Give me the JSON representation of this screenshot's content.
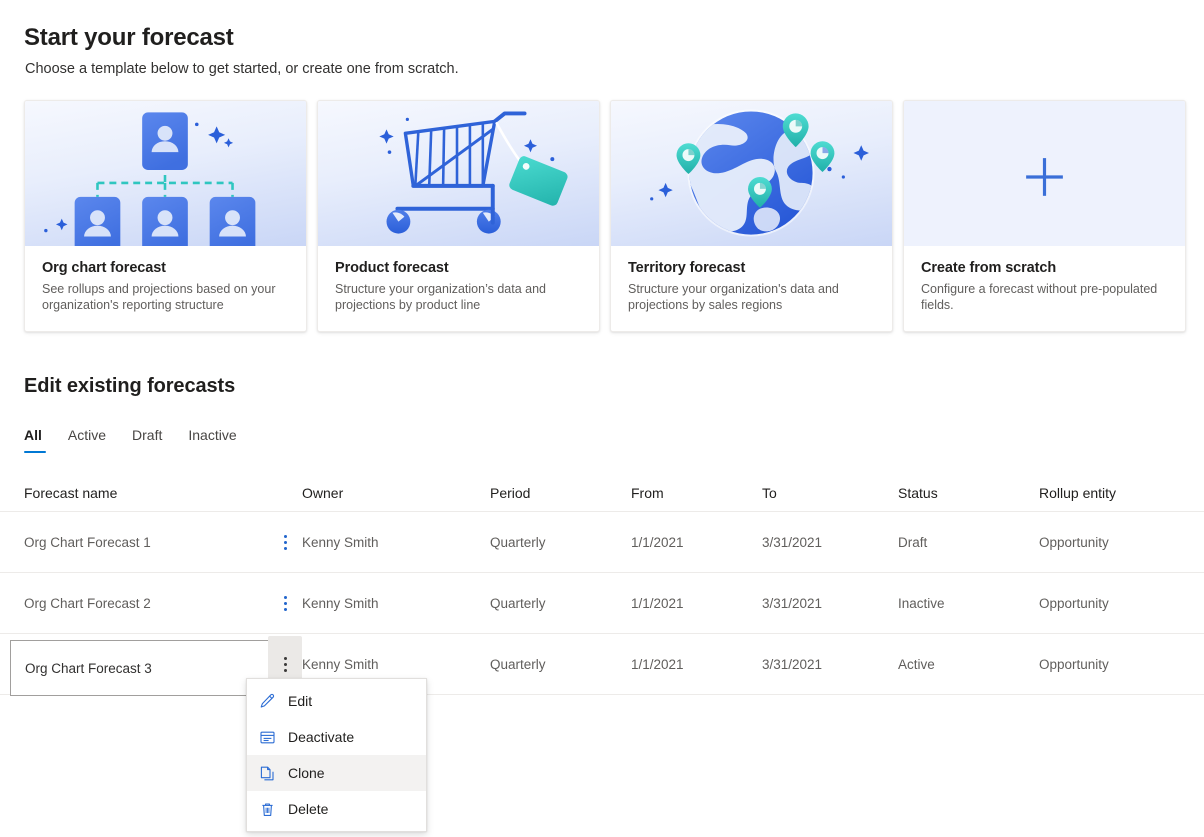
{
  "header": {
    "title": "Start your forecast",
    "subtitle": "Choose a template below to get started, or create one from scratch."
  },
  "templates": [
    {
      "id": "org-chart-forecast",
      "art": "org-chart-illustration",
      "title": "Org chart forecast",
      "desc": "See rollups and projections based on your organization's reporting structure"
    },
    {
      "id": "product-forecast",
      "art": "shopping-cart-illustration",
      "title": "Product forecast",
      "desc": "Structure your organization’s data and projections by product line"
    },
    {
      "id": "territory-forecast",
      "art": "globe-illustration",
      "title": "Territory forecast",
      "desc": "Structure your organization's data and projections by sales regions"
    },
    {
      "id": "create-from-scratch",
      "art": "plus-icon",
      "title": "Create from scratch",
      "desc": "Configure a forecast without pre-populated fields."
    }
  ],
  "existing": {
    "section_title": "Edit existing forecasts",
    "tabs": [
      {
        "label": "All",
        "selected": true
      },
      {
        "label": "Active",
        "selected": false
      },
      {
        "label": "Draft",
        "selected": false
      },
      {
        "label": "Inactive",
        "selected": false
      }
    ],
    "columns": {
      "name": "Forecast name",
      "owner": "Owner",
      "period": "Period",
      "from": "From",
      "to": "To",
      "status": "Status",
      "rollup": "Rollup entity"
    },
    "rows": [
      {
        "name": "Org Chart Forecast 1",
        "owner": "Kenny Smith",
        "period": "Quarterly",
        "from": "1/1/2021",
        "to": "3/31/2021",
        "status": "Draft",
        "rollup": "Opportunity"
      },
      {
        "name": "Org Chart Forecast 2",
        "owner": "Kenny Smith",
        "period": "Quarterly",
        "from": "1/1/2021",
        "to": "3/31/2021",
        "status": "Inactive",
        "rollup": "Opportunity"
      },
      {
        "name": "Org Chart Forecast 3",
        "owner": "Kenny Smith",
        "period": "Quarterly",
        "from": "1/1/2021",
        "to": "3/31/2021",
        "status": "Active",
        "rollup": "Opportunity"
      }
    ]
  },
  "context_menu": {
    "items": [
      {
        "label": "Edit",
        "icon": "pencil-icon",
        "hover": false
      },
      {
        "label": "Deactivate",
        "icon": "archive-icon",
        "hover": false
      },
      {
        "label": "Clone",
        "icon": "copy-icon",
        "hover": true
      },
      {
        "label": "Delete",
        "icon": "trash-icon",
        "hover": false
      }
    ]
  },
  "colors": {
    "accent": "#0078d4",
    "illustration_blue": "#4a7ae8",
    "illustration_teal": "#33c9c0",
    "text_primary": "#201f1e",
    "text_secondary": "#605e5c",
    "border": "#edebe9"
  }
}
